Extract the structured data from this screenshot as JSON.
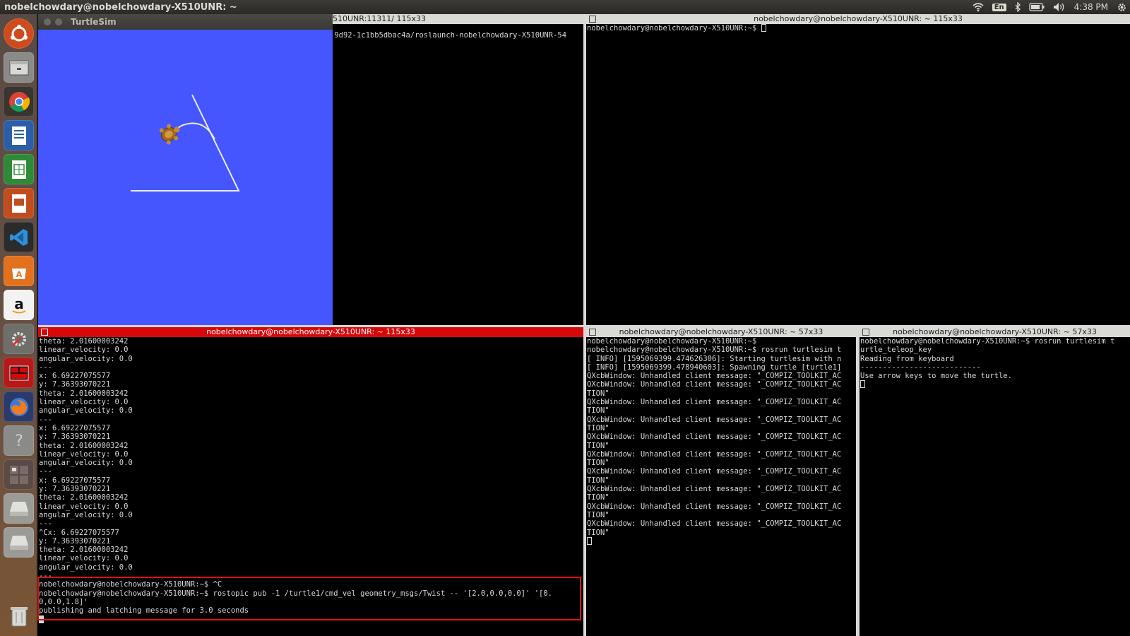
{
  "top_panel": {
    "title": "nobelchowdary@nobelchowdary-X510UNR: ~",
    "lang": "En",
    "time": "4:38 PM",
    "icons": [
      "wifi-icon",
      "bluetooth-icon",
      "battery-icon",
      "volume-icon",
      "gear-icon"
    ]
  },
  "launcher": {
    "items": [
      "ubuntu-dash",
      "files",
      "chrome",
      "writer",
      "calc",
      "impress",
      "vscode",
      "software-center",
      "amazon",
      "system-settings",
      "terminator",
      "firefox",
      "help",
      "workspace-switcher",
      "drive-1",
      "drive-2",
      "trash"
    ]
  },
  "turtlesim": {
    "title": "TurtleSim",
    "bg_color": "#4556ff"
  },
  "terminal_top_left": {
    "title": "510UNR:11311/ 115x33",
    "lines": [
      "-9d92-1c1bb5dbac4a/roslaunch-nobelchowdary-X510UNR-54"
    ]
  },
  "terminal_top_right": {
    "title": "nobelchowdary@nobelchowdary-X510UNR: ~ 115x33",
    "prompt": "nobelchowdary@nobelchowdary-X510UNR:~$ "
  },
  "terminal_bottom_left": {
    "title": "nobelchowdary@nobelchowdary-X510UNR: ~ 115x33",
    "lines": [
      "theta: 2.01600003242",
      "linear_velocity: 0.0",
      "angular_velocity: 0.0",
      "---",
      "x: 6.69227075577",
      "y: 7.36393070221",
      "theta: 2.01600003242",
      "linear_velocity: 0.0",
      "angular_velocity: 0.0",
      "---",
      "x: 6.69227075577",
      "y: 7.36393070221",
      "theta: 2.01600003242",
      "linear_velocity: 0.0",
      "angular_velocity: 0.0",
      "---",
      "x: 6.69227075577",
      "y: 7.36393070221",
      "theta: 2.01600003242",
      "linear_velocity: 0.0",
      "angular_velocity: 0.0",
      "---",
      "^Cx: 6.69227075577",
      "y: 7.36393070221",
      "theta: 2.01600003242",
      "linear_velocity: 0.0",
      "angular_velocity: 0.0",
      "---",
      "nobelchowdary@nobelchowdary-X510UNR:~$ ^C",
      "nobelchowdary@nobelchowdary-X510UNR:~$ rostopic pub -1 /turtle1/cmd_vel geometry_msgs/Twist -- '[2.0,0.0,0.0]' '[0.",
      "0,0.0,1.8]'",
      "publishing and latching message for 3.0 seconds"
    ]
  },
  "terminal_bottom_mid": {
    "title": "nobelchowdary@nobelchowdary-X510UNR: ~ 57x33",
    "lines": [
      "nobelchowdary@nobelchowdary-X510UNR:~$",
      "nobelchowdary@nobelchowdary-X510UNR:~$ rosrun turtlesim t",
      "[ INFO] [1595069399.474626306]: Starting turtlesim with n",
      "[ INFO] [1595069399.478940603]: Spawning turtle [turtle1]",
      "QXcbWindow: Unhandled client message: \"_COMPIZ_TOOLKIT_AC",
      "QXcbWindow: Unhandled client message: \"_COMPIZ_TOOLKIT_AC",
      "TION\"",
      "QXcbWindow: Unhandled client message: \"_COMPIZ_TOOLKIT_AC",
      "TION\"",
      "QXcbWindow: Unhandled client message: \"_COMPIZ_TOOLKIT_AC",
      "TION\"",
      "QXcbWindow: Unhandled client message: \"_COMPIZ_TOOLKIT_AC",
      "TION\"",
      "QXcbWindow: Unhandled client message: \"_COMPIZ_TOOLKIT_AC",
      "TION\"",
      "QXcbWindow: Unhandled client message: \"_COMPIZ_TOOLKIT_AC",
      "TION\"",
      "QXcbWindow: Unhandled client message: \"_COMPIZ_TOOLKIT_AC",
      "TION\"",
      "QXcbWindow: Unhandled client message: \"_COMPIZ_TOOLKIT_AC",
      "TION\"",
      "QXcbWindow: Unhandled client message: \"_COMPIZ_TOOLKIT_AC",
      "TION\""
    ]
  },
  "terminal_bottom_right": {
    "title": "nobelchowdary@nobelchowdary-X510UNR: ~ 57x33",
    "lines": [
      "nobelchowdary@nobelchowdary-X510UNR:~$ rosrun turtlesim t",
      "urtle_teleop_key",
      "Reading from keyboard",
      "---------------------------",
      "Use arrow keys to move the turtle."
    ]
  }
}
